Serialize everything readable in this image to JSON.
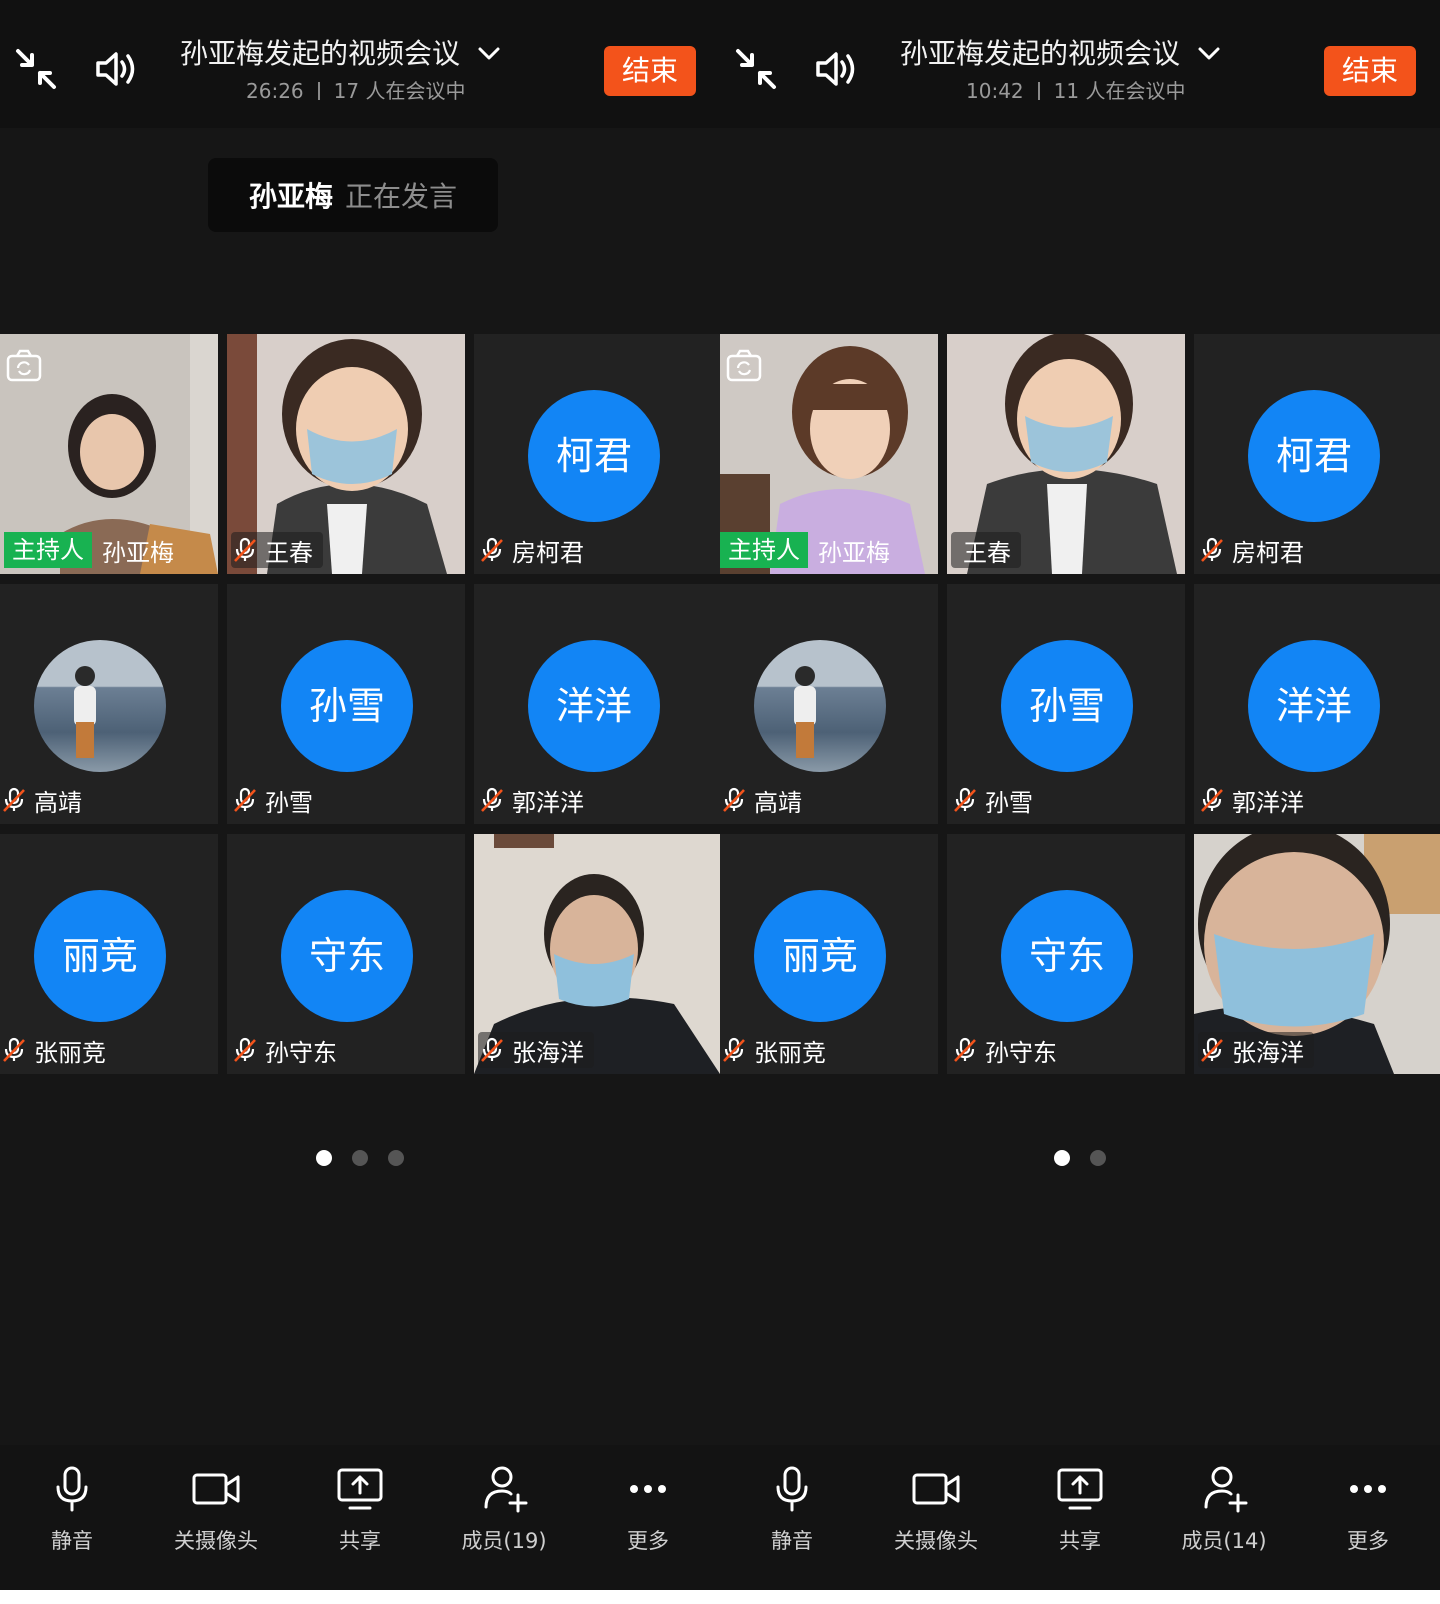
{
  "screens": [
    {
      "header": {
        "title": "孙亚梅发起的视频会议",
        "duration": "26:26",
        "participants_text": "17 人在会议中",
        "end_label": "结束"
      },
      "speaking": {
        "name": "孙亚梅",
        "status": "正在发言"
      },
      "tiles": [
        {
          "kind": "video",
          "host_badge": "主持人",
          "name": "孙亚梅"
        },
        {
          "kind": "video",
          "name": "王春"
        },
        {
          "kind": "avatar",
          "avatar_text": "柯君",
          "name": "房柯君"
        },
        {
          "kind": "photo",
          "name": "高靖"
        },
        {
          "kind": "avatar",
          "avatar_text": "孙雪",
          "name": "孙雪"
        },
        {
          "kind": "avatar",
          "avatar_text": "洋洋",
          "name": "郭洋洋"
        },
        {
          "kind": "avatar",
          "avatar_text": "丽竞",
          "name": "张丽竞"
        },
        {
          "kind": "avatar",
          "avatar_text": "守东",
          "name": "孙守东"
        },
        {
          "kind": "video",
          "name": "张海洋"
        }
      ],
      "page_count": 3,
      "active_page": 1,
      "toolbar": {
        "mute": "静音",
        "camera_off": "关摄像头",
        "share": "共享",
        "members": "成员(19)",
        "more": "更多"
      }
    },
    {
      "header": {
        "title": "孙亚梅发起的视频会议",
        "duration": "10:42",
        "participants_text": "11 人在会议中",
        "end_label": "结束"
      },
      "tiles": [
        {
          "kind": "video",
          "host_badge": "主持人",
          "name": "孙亚梅"
        },
        {
          "kind": "video",
          "name": "王春"
        },
        {
          "kind": "avatar",
          "avatar_text": "柯君",
          "name": "房柯君"
        },
        {
          "kind": "photo",
          "name": "高靖"
        },
        {
          "kind": "avatar",
          "avatar_text": "孙雪",
          "name": "孙雪"
        },
        {
          "kind": "avatar",
          "avatar_text": "洋洋",
          "name": "郭洋洋"
        },
        {
          "kind": "avatar",
          "avatar_text": "丽竞",
          "name": "张丽竞"
        },
        {
          "kind": "avatar",
          "avatar_text": "守东",
          "name": "孙守东"
        },
        {
          "kind": "video",
          "name": "张海洋"
        }
      ],
      "page_count": 2,
      "active_page": 1,
      "toolbar": {
        "mute": "静音",
        "camera_off": "关摄像头",
        "share": "共享",
        "members": "成员(14)",
        "more": "更多"
      }
    }
  ],
  "colors": {
    "end": "#f3531b",
    "avatar": "#1285f5",
    "host": "#18b251",
    "background": "#161616"
  },
  "icons": [
    "collapse-icon",
    "speaker-icon",
    "chevron-down-icon",
    "camera-switch-icon",
    "mic-muted-icon",
    "mic-icon",
    "video-camera-icon",
    "screen-share-icon",
    "add-member-icon",
    "more-icon"
  ]
}
